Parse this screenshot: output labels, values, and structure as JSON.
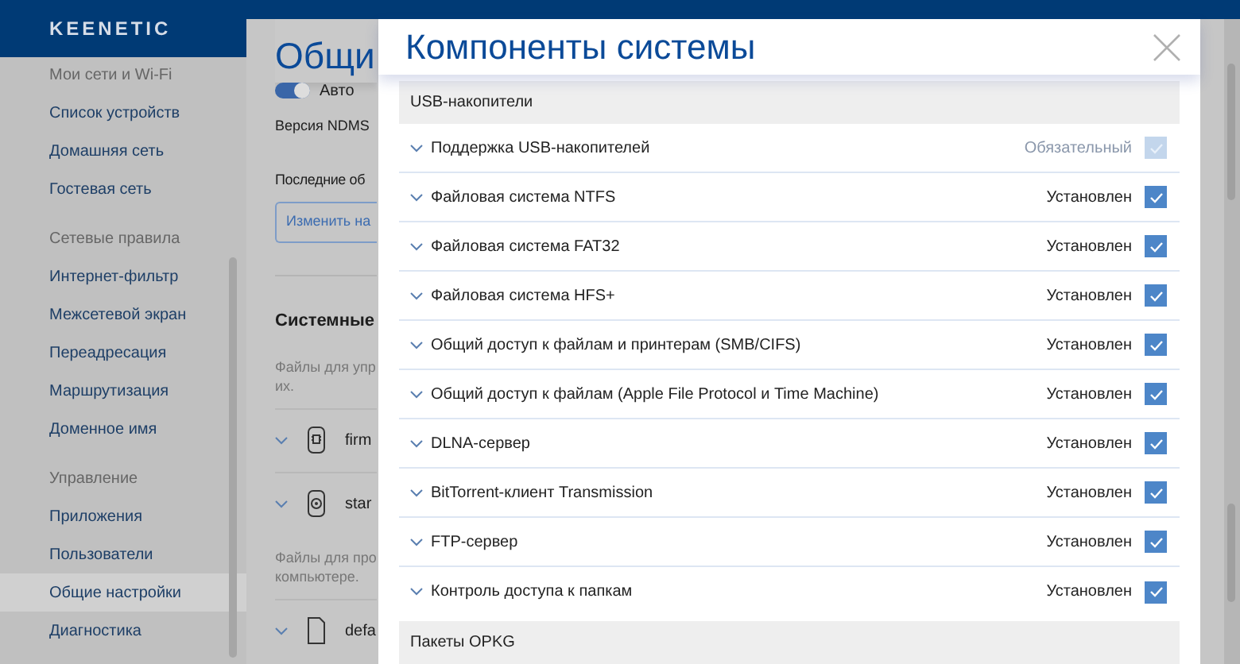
{
  "brand": "KEENETIC",
  "sidebar": {
    "items": [
      {
        "kind": "section",
        "label": "Мои сети и Wi-Fi"
      },
      {
        "kind": "link",
        "label": "Список устройств",
        "selected": false
      },
      {
        "kind": "link",
        "label": "Домашняя сеть",
        "selected": false
      },
      {
        "kind": "link",
        "label": "Гостевая сеть",
        "selected": false
      },
      {
        "kind": "section",
        "label": "Сетевые правила"
      },
      {
        "kind": "link",
        "label": "Интернет-фильтр",
        "selected": false
      },
      {
        "kind": "link",
        "label": "Межсетевой экран",
        "selected": false
      },
      {
        "kind": "link",
        "label": "Переадресация",
        "selected": false
      },
      {
        "kind": "link",
        "label": "Маршрутизация",
        "selected": false
      },
      {
        "kind": "link",
        "label": "Доменное имя",
        "selected": false
      },
      {
        "kind": "section",
        "label": "Управление"
      },
      {
        "kind": "link",
        "label": "Приложения",
        "selected": false
      },
      {
        "kind": "link",
        "label": "Пользователи",
        "selected": false
      },
      {
        "kind": "link",
        "label": "Общие настройки",
        "selected": true
      },
      {
        "kind": "link",
        "label": "Диагностика",
        "selected": false
      }
    ]
  },
  "page": {
    "title": "Общи",
    "toggle": {
      "label": "Авто",
      "on": true
    },
    "version_label": "Версия NDMS",
    "updates_label": "Последние об",
    "change_button": "Изменить на",
    "files_title": "Системные",
    "files_note": "Файлы для упр их.",
    "files": [
      {
        "name": "firm"
      },
      {
        "name": "star"
      }
    ],
    "files_note_2": "Файлы для про компьютере.",
    "files_2": [
      {
        "name": "defa"
      }
    ]
  },
  "dialog": {
    "title": "Компоненты системы",
    "sections": [
      {
        "title": "USB-накопители",
        "rows": [
          {
            "label": "Поддержка USB-накопителей",
            "status": "Обязательный",
            "checked": true,
            "disabled": true
          },
          {
            "label": "Файловая система NTFS",
            "status": "Установлен",
            "checked": true,
            "disabled": false
          },
          {
            "label": "Файловая система FAT32",
            "status": "Установлен",
            "checked": true,
            "disabled": false
          },
          {
            "label": "Файловая система HFS+",
            "status": "Установлен",
            "checked": true,
            "disabled": false
          },
          {
            "label": "Общий доступ к файлам и принтерам (SMB/CIFS)",
            "status": "Установлен",
            "checked": true,
            "disabled": false
          },
          {
            "label": "Общий доступ к файлам (Apple File Protocol и Time Machine)",
            "status": "Установлен",
            "checked": true,
            "disabled": false
          },
          {
            "label": "DLNA-сервер",
            "status": "Установлен",
            "checked": true,
            "disabled": false
          },
          {
            "label": "BitTorrent-клиент Transmission",
            "status": "Установлен",
            "checked": true,
            "disabled": false
          },
          {
            "label": "FTP-сервер",
            "status": "Установлен",
            "checked": true,
            "disabled": false
          },
          {
            "label": "Контроль доступа к папкам",
            "status": "Установлен",
            "checked": true,
            "disabled": false
          }
        ]
      },
      {
        "title": "Пакеты OPKG"
      }
    ]
  }
}
